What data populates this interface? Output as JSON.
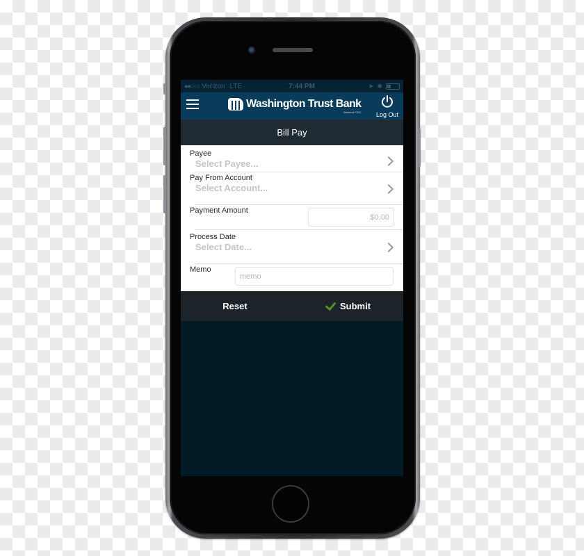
{
  "status_bar": {
    "carrier": "Verizon",
    "network": "LTE",
    "time": "7:44 PM",
    "icons": [
      "location-icon",
      "bluetooth-icon",
      "battery-icon"
    ]
  },
  "header": {
    "menu_icon": "hamburger-menu-icon",
    "brand_name": "Washington Trust Bank",
    "brand_sub": "Member FDIC",
    "logout_label": "Log Out",
    "logout_icon": "power-icon",
    "brand_color": "#093c5b"
  },
  "page": {
    "title": "Bill Pay"
  },
  "form": {
    "payee": {
      "label": "Payee",
      "placeholder": "Select Payee..."
    },
    "account": {
      "label": "Pay From Account",
      "placeholder": "Select Account..."
    },
    "amount": {
      "label": "Payment Amount",
      "placeholder": "$0.00",
      "value": ""
    },
    "date": {
      "label": "Process Date",
      "placeholder": "Select Date..."
    },
    "memo": {
      "label": "Memo",
      "placeholder": "memo",
      "value": ""
    }
  },
  "actions": {
    "reset_label": "Reset",
    "submit_label": "Submit",
    "submit_icon": "checkmark-icon",
    "submit_icon_color": "#5c8a2a"
  }
}
